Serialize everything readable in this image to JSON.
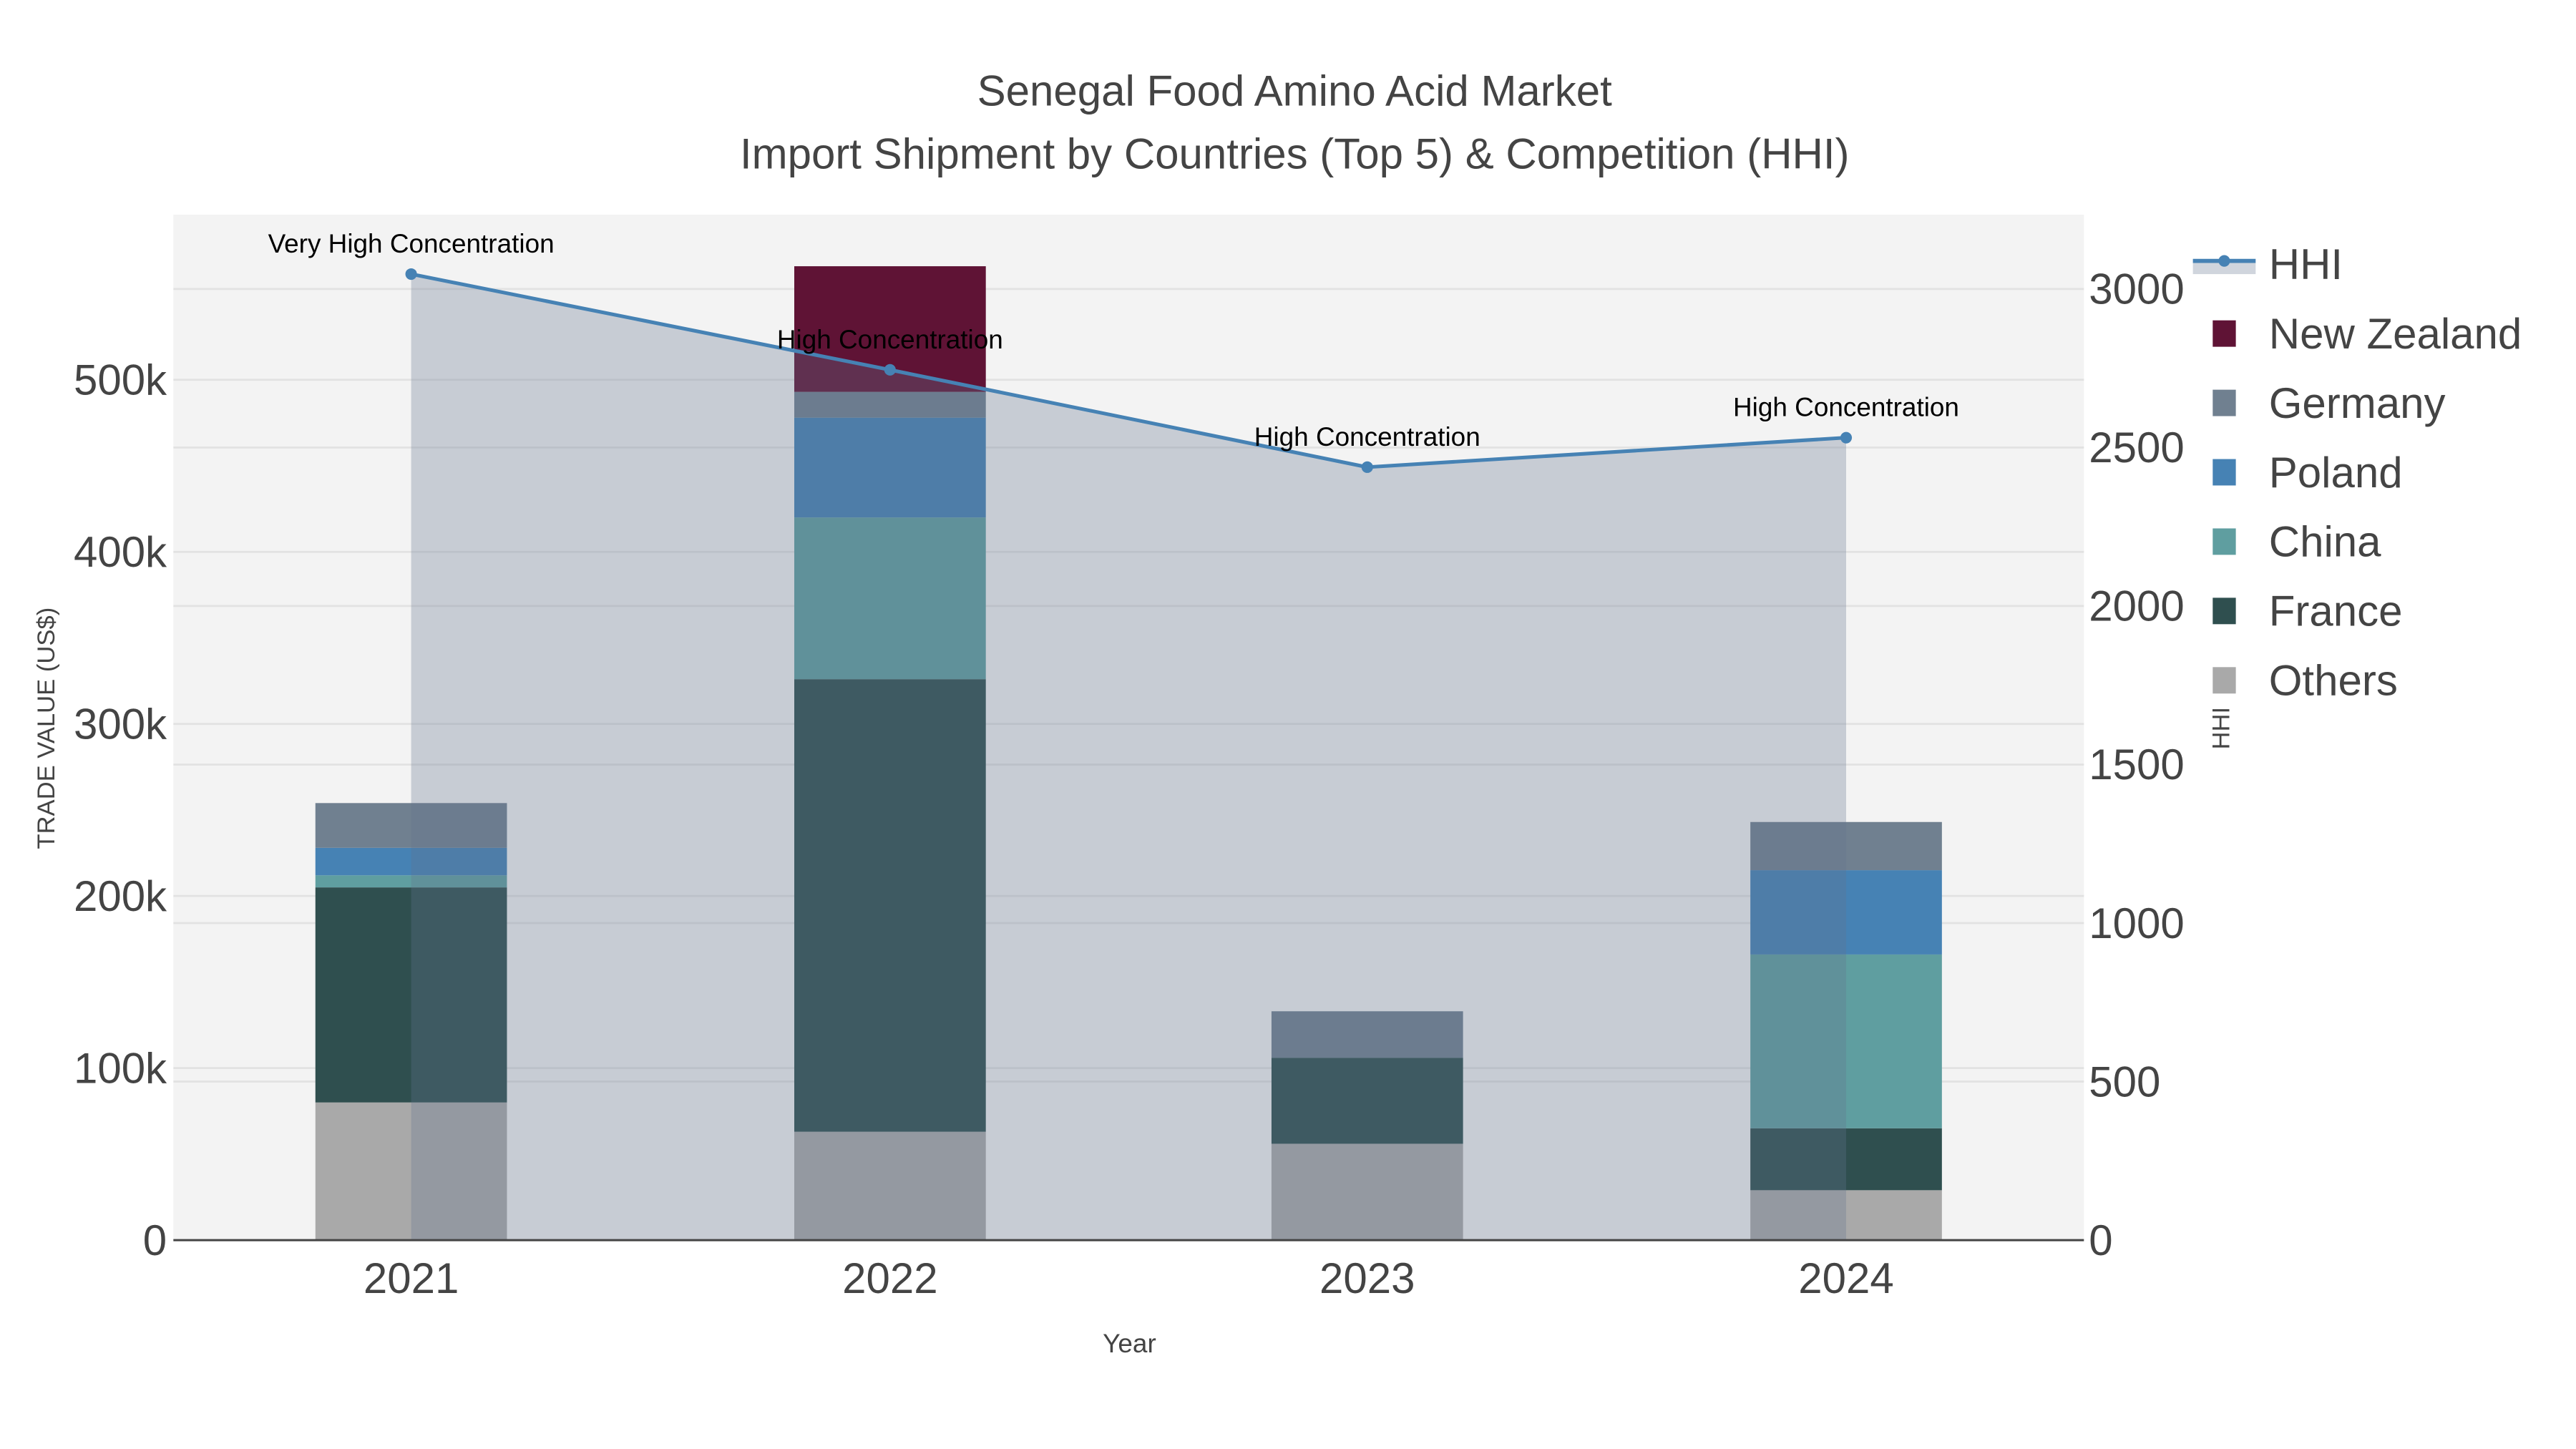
{
  "chart_data": {
    "type": "bar",
    "title": "Senegal Food Amino Acid Market",
    "subtitle": "Import Shipment by Countries (Top 5) & Competition (HHI)",
    "xlabel": "Year",
    "ylabel": "TRADE VALUE (US$)",
    "y2label": "HHI",
    "categories": [
      "2021",
      "2022",
      "2023",
      "2024"
    ],
    "ylim": [
      0,
      590000
    ],
    "y2lim": [
      0,
      3230
    ],
    "yticks": [
      0,
      100000,
      200000,
      300000,
      400000,
      500000
    ],
    "ytick_labels": [
      "0",
      "100k",
      "200k",
      "300k",
      "400k",
      "500k"
    ],
    "y2ticks": [
      0,
      500,
      1000,
      1500,
      2000,
      2500,
      3000
    ],
    "y2tick_labels": [
      "0",
      "500",
      "1000",
      "1500",
      "2000",
      "2500",
      "3000"
    ],
    "stacked": true,
    "series": [
      {
        "name": "Others",
        "color": "#a9a9a9",
        "values": [
          80000,
          63000,
          56000,
          29000
        ]
      },
      {
        "name": "France",
        "color": "#2f4f4f",
        "values": [
          125000,
          263000,
          50000,
          36000
        ]
      },
      {
        "name": "China",
        "color": "#5f9ea0",
        "values": [
          7000,
          94000,
          0,
          101000
        ]
      },
      {
        "name": "Poland",
        "color": "#4682b4",
        "values": [
          16000,
          58000,
          0,
          49000
        ]
      },
      {
        "name": "Germany",
        "color": "#708090",
        "values": [
          26000,
          15000,
          27000,
          28000
        ]
      },
      {
        "name": "New Zealand",
        "color": "#5f1335",
        "values": [
          0,
          73000,
          0,
          0
        ]
      }
    ],
    "hhi": {
      "name": "HHI",
      "color": "#4682b4",
      "values": [
        3047,
        2745,
        2438,
        2531
      ],
      "annotations": [
        "Very High Concentration",
        "High Concentration",
        "High Concentration",
        "High Concentration"
      ]
    },
    "legend": [
      "HHI",
      "New Zealand",
      "Germany",
      "Poland",
      "China",
      "France",
      "Others"
    ],
    "legend_position": "right",
    "grid": true
  }
}
